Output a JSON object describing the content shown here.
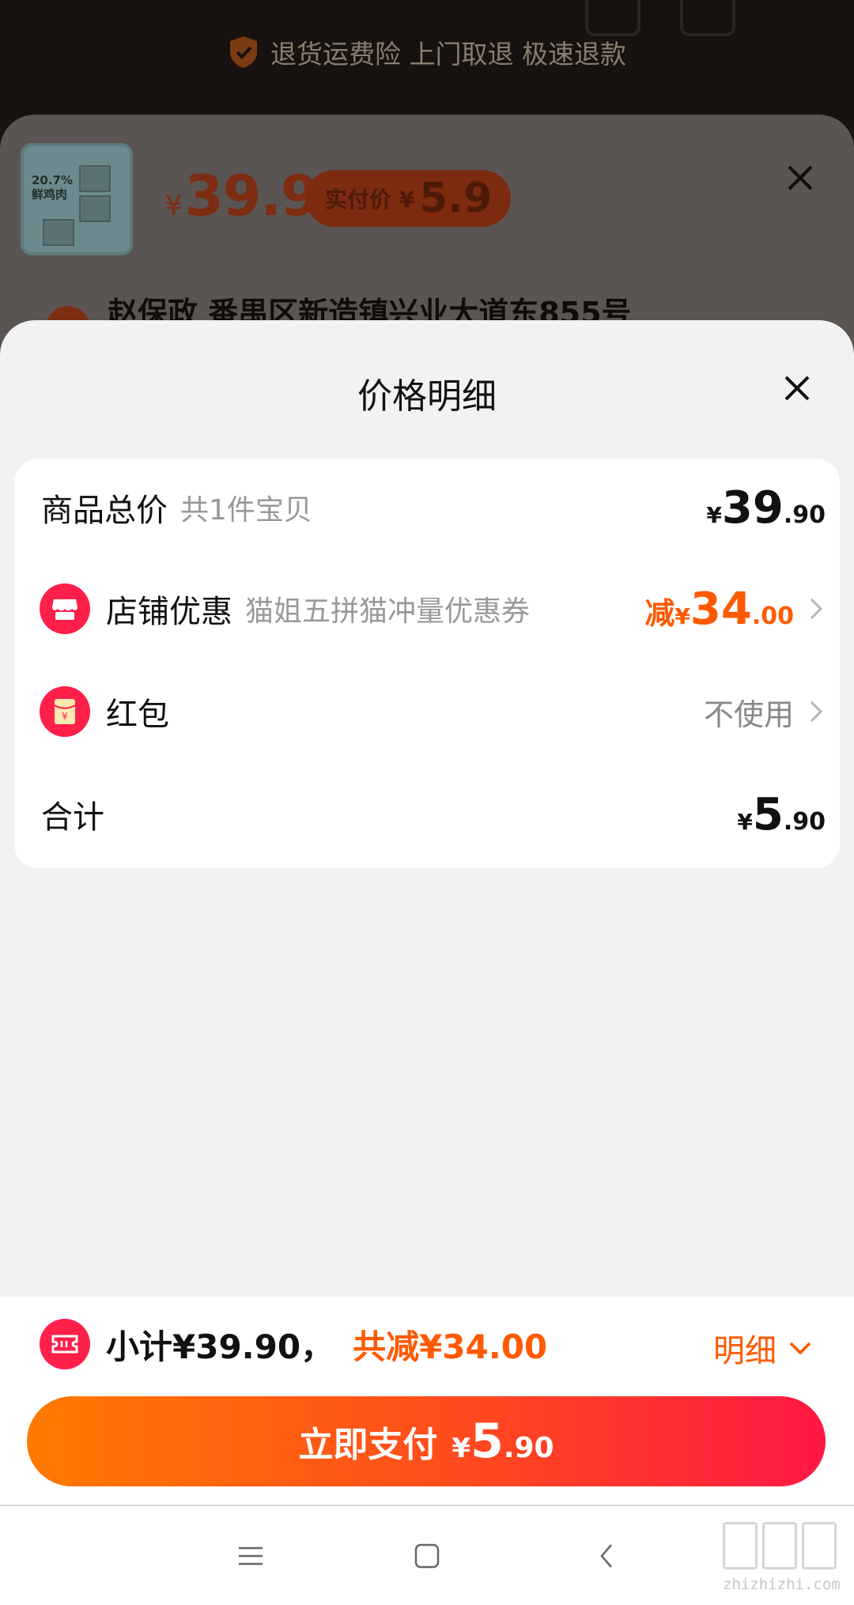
{
  "background": {
    "guarantee_text": "退货运费险 上门取退 极速退款",
    "product": {
      "thumb_text": "20.7%\n鲜鸡肉",
      "price_symbol": "¥",
      "price": "39.9",
      "paid_label": "实付价 ¥",
      "paid_value": "5.9"
    },
    "address": "赵保政 番禺区新造镇兴业大道东855号"
  },
  "sheet": {
    "title": "价格明细",
    "rows": [
      {
        "label": "商品总价",
        "sub": "共1件宝贝",
        "yen": "¥",
        "int": "39",
        "dec": ".90"
      },
      {
        "label": "店铺优惠",
        "sub": "猫姐五拼猫冲量优惠券",
        "prefix": "减",
        "yen": "¥",
        "int": "34",
        "dec": ".00",
        "icon": "store-icon"
      },
      {
        "label": "红包",
        "right_text": "不使用",
        "icon": "red-packet-icon"
      },
      {
        "label": "合计",
        "yen": "¥",
        "int": "5",
        "dec": ".90"
      }
    ]
  },
  "bottom": {
    "subtotal": "小计¥39.90，",
    "discount": "共减¥34.00",
    "detail_label": "明细",
    "pay_label": "立即支付",
    "pay_yen": "¥",
    "pay_int": "5",
    "pay_dec": ".90"
  },
  "watermark": {
    "text": "zhizhizhi.com"
  },
  "colors": {
    "accent_orange": "#ff5a00",
    "accent_red": "#ff1f4b",
    "pay_gradient_start": "#ff7a00",
    "pay_gradient_end": "#ff1744"
  }
}
